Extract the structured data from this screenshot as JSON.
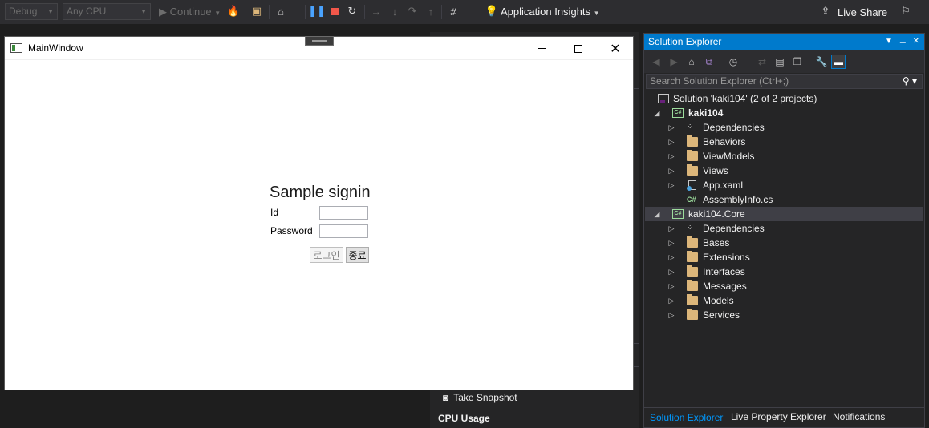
{
  "toolbar": {
    "config": "Debug",
    "platform": "Any CPU",
    "continue": "Continue",
    "app_insights": "Application Insights",
    "live_share": "Live Share"
  },
  "main_window": {
    "title": "MainWindow",
    "heading": "Sample signin",
    "id_label": "Id",
    "password_label": "Password",
    "id_value": "",
    "password_value": "",
    "login_button": "로그인",
    "exit_button": "종료"
  },
  "diagnostics": {
    "take_snapshot": "Take Snapshot",
    "cpu_usage": "CPU Usage"
  },
  "solution_explorer": {
    "title": "Solution Explorer",
    "search_placeholder": "Search Solution Explorer (Ctrl+;)",
    "tree": {
      "solution": "Solution 'kaki104' (2 of 2 projects)",
      "project1": "kaki104",
      "p1_dependencies": "Dependencies",
      "p1_behaviors": "Behaviors",
      "p1_viewmodels": "ViewModels",
      "p1_views": "Views",
      "p1_app": "App.xaml",
      "p1_assemblyinfo": "AssemblyInfo.cs",
      "project2": "kaki104.Core",
      "p2_dependencies": "Dependencies",
      "p2_bases": "Bases",
      "p2_extensions": "Extensions",
      "p2_interfaces": "Interfaces",
      "p2_messages": "Messages",
      "p2_models": "Models",
      "p2_services": "Services"
    },
    "tabs": {
      "solution_explorer": "Solution Explorer",
      "live_property": "Live Property Explorer",
      "notifications": "Notifications"
    }
  },
  "colors": {
    "accent": "#007acc",
    "stop": "#f1574a",
    "pause": "#4aa3ff",
    "folder": "#dcb67a"
  }
}
